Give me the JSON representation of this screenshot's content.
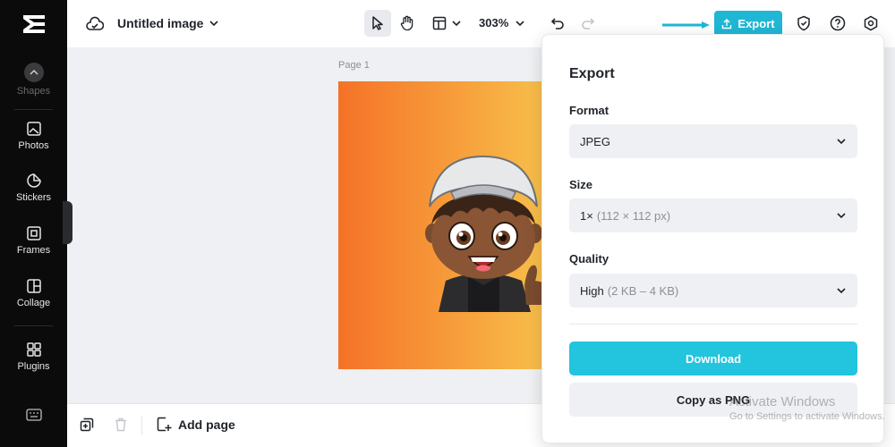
{
  "app": {
    "logo_icon": "capcut-logo-icon"
  },
  "sidebar": {
    "items": [
      {
        "label": "Shapes",
        "icon": "shapes-icon"
      },
      {
        "label": "Photos",
        "icon": "photos-icon"
      },
      {
        "label": "Stickers",
        "icon": "stickers-icon"
      },
      {
        "label": "Frames",
        "icon": "frames-icon"
      },
      {
        "label": "Collage",
        "icon": "collage-icon"
      },
      {
        "label": "Plugins",
        "icon": "plugins-icon"
      }
    ],
    "keyboard_icon": "keyboard-icon"
  },
  "topbar": {
    "title": "Untitled image",
    "zoom": "303%",
    "export_label": "Export"
  },
  "canvas": {
    "page_label": "Page 1",
    "gradient_colors": [
      "#f57227",
      "#f7a23d",
      "#f7c24c"
    ]
  },
  "bottombar": {
    "add_page_label": "Add page"
  },
  "export_panel": {
    "title": "Export",
    "format": {
      "label": "Format",
      "value": "JPEG"
    },
    "size": {
      "label": "Size",
      "value": "1×",
      "detail": "(112 × 112 px)"
    },
    "quality": {
      "label": "Quality",
      "value": "High",
      "detail": "(2 KB – 4 KB)"
    },
    "download_label": "Download",
    "copy_label": "Copy as PNG"
  },
  "watermark": {
    "line1": "Activate Windows",
    "line2": "Go to Settings to activate Windows."
  },
  "colors": {
    "accent": "#22c4de",
    "export_button": "#1fb7d4",
    "sidebar_bg": "#0b0b0c"
  }
}
